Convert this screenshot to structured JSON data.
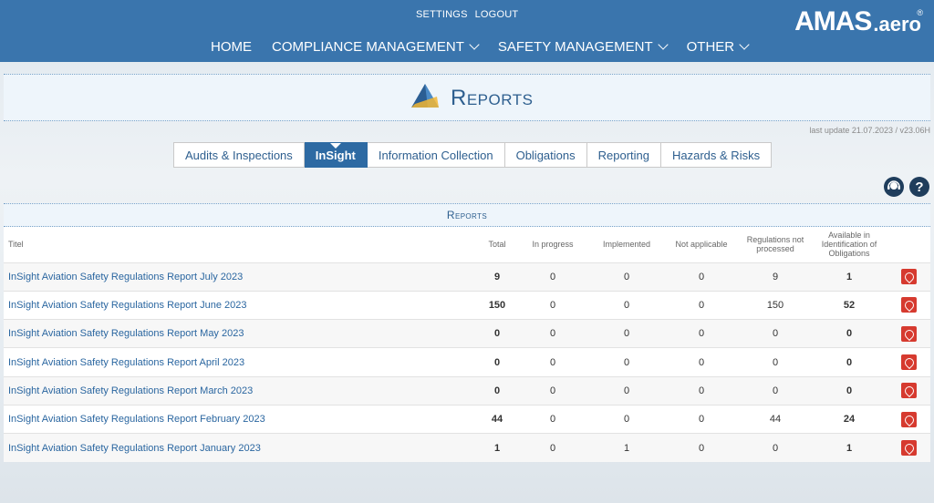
{
  "header": {
    "util_links": [
      "SETTINGS",
      "LOGOUT"
    ],
    "nav": [
      {
        "label": "HOME",
        "dropdown": false
      },
      {
        "label": "COMPLIANCE MANAGEMENT",
        "dropdown": true
      },
      {
        "label": "SAFETY MANAGEMENT",
        "dropdown": true
      },
      {
        "label": "OTHER",
        "dropdown": true
      }
    ],
    "logo_text": "AMAS",
    "logo_sub": ".aero",
    "logo_reg": "®"
  },
  "page": {
    "title": "Reports",
    "last_update": "last update 21.07.2023 / v23.06H"
  },
  "tabs": [
    {
      "label": "Audits & Inspections",
      "active": false
    },
    {
      "label": "InSight",
      "active": true
    },
    {
      "label": "Information Collection",
      "active": false
    },
    {
      "label": "Obligations",
      "active": false
    },
    {
      "label": "Reporting",
      "active": false
    },
    {
      "label": "Hazards & Risks",
      "active": false
    }
  ],
  "help_icons": [
    "support-agent-icon",
    "question-icon"
  ],
  "panel": {
    "header": "Reports",
    "columns": [
      "Titel",
      "Total",
      "In progress",
      "Implemented",
      "Not applicable",
      "Regulations not processed",
      "Available in Identification of Obligations"
    ],
    "rows": [
      {
        "title": "InSight Aviation Safety Regulations Report July 2023",
        "total": "9",
        "in_progress": "0",
        "implemented": "0",
        "not_applicable": "0",
        "not_processed": "9",
        "available": "1"
      },
      {
        "title": "InSight Aviation Safety Regulations Report June 2023",
        "total": "150",
        "in_progress": "0",
        "implemented": "0",
        "not_applicable": "0",
        "not_processed": "150",
        "available": "52"
      },
      {
        "title": "InSight Aviation Safety Regulations Report May 2023",
        "total": "0",
        "in_progress": "0",
        "implemented": "0",
        "not_applicable": "0",
        "not_processed": "0",
        "available": "0"
      },
      {
        "title": "InSight Aviation Safety Regulations Report April 2023",
        "total": "0",
        "in_progress": "0",
        "implemented": "0",
        "not_applicable": "0",
        "not_processed": "0",
        "available": "0"
      },
      {
        "title": "InSight Aviation Safety Regulations Report March 2023",
        "total": "0",
        "in_progress": "0",
        "implemented": "0",
        "not_applicable": "0",
        "not_processed": "0",
        "available": "0"
      },
      {
        "title": "InSight Aviation Safety Regulations Report February 2023",
        "total": "44",
        "in_progress": "0",
        "implemented": "0",
        "not_applicable": "0",
        "not_processed": "44",
        "available": "24"
      },
      {
        "title": "InSight Aviation Safety Regulations Report January 2023",
        "total": "1",
        "in_progress": "0",
        "implemented": "1",
        "not_applicable": "0",
        "not_processed": "0",
        "available": "1"
      }
    ],
    "row_icon": "pdf-icon"
  },
  "colors": {
    "topbar": "#3a75ad",
    "active_tab": "#2d6aa3",
    "link": "#2a66a0",
    "pdf": "#d63a2f"
  }
}
